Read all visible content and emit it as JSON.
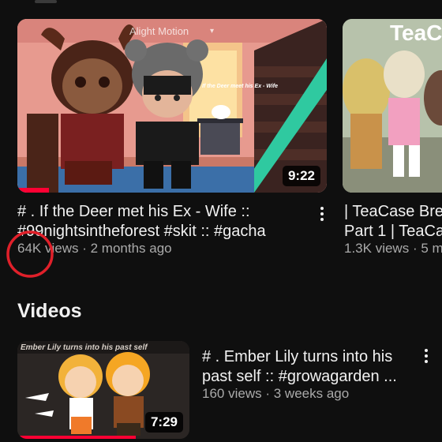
{
  "featured": [
    {
      "title_line1": "# . If the Deer met his Ex - Wife ::",
      "title_line2": "#99nightsintheforest #skit :: #gacha",
      "views": "64K views",
      "age": "2 months ago",
      "duration": "9:22",
      "watermark": "Alight Motion",
      "caption": "If the Deer meet his Ex - Wife",
      "watch_progress": 0.1
    },
    {
      "title_line1": "| TeaCase Bre",
      "title_line2": "Part 1 | TeaCa",
      "views": "1.3K views",
      "age": "5 m",
      "thumb_text": "TeaC"
    }
  ],
  "section": {
    "title": "Videos"
  },
  "videos": [
    {
      "title_line1": "# . Ember Lily turns into his",
      "title_line2": "past self :: #growagarden ...",
      "views": "160 views",
      "age": "3 weeks ago",
      "duration": "7:29",
      "overlay": "Ember Lily turns into his past self",
      "watch_progress": 0.7
    }
  ],
  "separator": "·",
  "colors": {
    "background": "#0f0f0f",
    "annotation": "#e0202a",
    "progress": "#ff0033"
  }
}
